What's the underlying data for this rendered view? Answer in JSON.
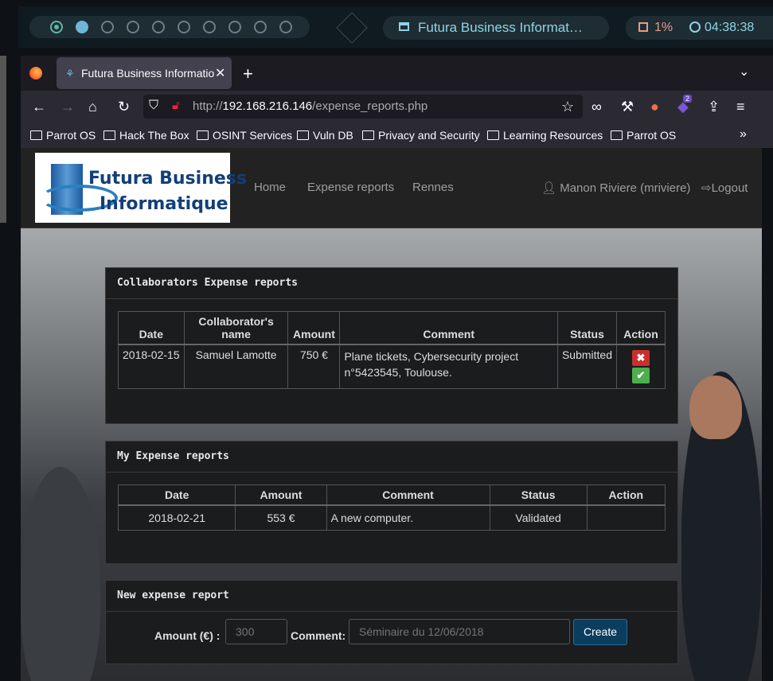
{
  "desktop": {
    "workspaces": 10,
    "active_workspace": 1,
    "window_title": "Futura Business Informat…",
    "cpu": "1%",
    "clock": "04:38:38"
  },
  "browser": {
    "tab_title": "Futura Business Informatio",
    "url_prefix": "http://",
    "url_host": "192.168.216.146",
    "url_path": "/expense_reports.php",
    "bookmarks": [
      "Parrot OS",
      "Hack The Box",
      "OSINT Services",
      "Vuln DB",
      "Privacy and Security",
      "Learning Resources",
      "Parrot OS"
    ],
    "extension_badge": "2"
  },
  "site": {
    "logo_line1": "Futura Business",
    "logo_line2": "Informatique",
    "nav": [
      "Home",
      "Expense reports",
      "Rennes"
    ],
    "user": "Manon Riviere (mriviere)",
    "logout": "Logout"
  },
  "collab": {
    "title": "Collaborators Expense reports",
    "headers": [
      "Date",
      "Collaborator's name",
      "Amount",
      "Comment",
      "Status",
      "Action"
    ],
    "rows": [
      [
        "2018-02-15",
        "Samuel Lamotte",
        "750 €",
        "Plane tickets, Cybersecurity project n°5423545, Toulouse.",
        "Submitted"
      ]
    ]
  },
  "mine": {
    "title": "My Expense reports",
    "headers": [
      "Date",
      "Amount",
      "Comment",
      "Status",
      "Action"
    ],
    "rows": [
      [
        "2018-02-21",
        "553 €",
        "A new computer.",
        "Validated",
        ""
      ]
    ]
  },
  "newreport": {
    "title": "New expense report",
    "amount_label": "Amount (€) :",
    "amount_placeholder": "300",
    "comment_label": "Comment:",
    "comment_placeholder": "Séminaire du 12/06/2018",
    "create": "Create"
  },
  "colors": {
    "accent": "#8fd3e6",
    "reject": "#c9302c",
    "validate": "#4cae4c",
    "create_btn": "#0b3e5e"
  }
}
